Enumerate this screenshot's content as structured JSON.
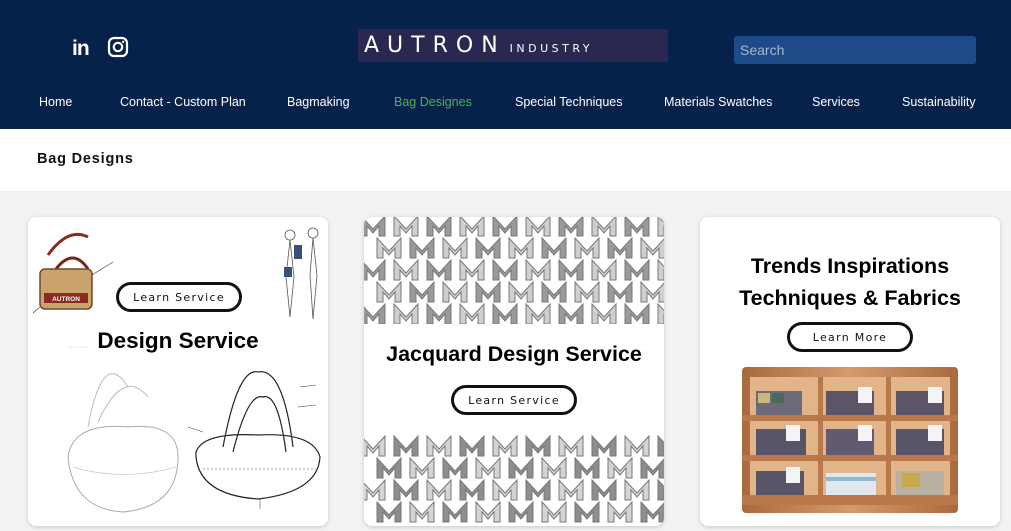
{
  "header": {
    "logo_main": "AUTRON",
    "logo_sub": "INDUSTRY",
    "social": {
      "linkedin": "in"
    },
    "search": {
      "placeholder": "Search"
    },
    "nav": [
      {
        "label": "Home"
      },
      {
        "label": "Contact - Custom Plan"
      },
      {
        "label": "Bagmaking"
      },
      {
        "label": "Bag Designes"
      },
      {
        "label": "Special Techniques"
      },
      {
        "label": "Materials Swatches"
      },
      {
        "label": "Services"
      },
      {
        "label": "Sustainability"
      }
    ],
    "active_nav": "Bag Designes"
  },
  "page": {
    "title": "Bag Designs"
  },
  "cards": [
    {
      "title": "Design Service",
      "button": "Learn Service",
      "bag_logo": "AUTRON"
    },
    {
      "title": "Jacquard Design Service",
      "button": "Learn Service"
    },
    {
      "title_line1": "Trends Inspirations",
      "title_line2": "Techniques & Fabrics",
      "button": "Learn More"
    }
  ],
  "colors": {
    "header_bg": "#07224a",
    "nav_active": "#4fb05a",
    "search_bg": "#1d4a88",
    "logo_bg": "#2a2850",
    "page_bg": "#f2f2f2",
    "shelf_wood": "#c98a5a"
  },
  "icons": [
    "linkedin-icon",
    "instagram-icon"
  ]
}
